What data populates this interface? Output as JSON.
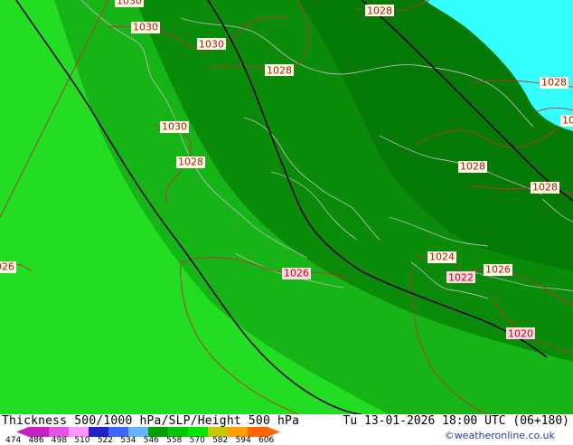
{
  "map": {
    "pressure_labels": [
      {
        "text": "1030"
      },
      {
        "text": "1030"
      },
      {
        "text": "1030"
      },
      {
        "text": "1030"
      },
      {
        "text": "1028"
      },
      {
        "text": "1028"
      },
      {
        "text": "1028"
      },
      {
        "text": "1028"
      },
      {
        "text": "1028"
      },
      {
        "text": "1028"
      },
      {
        "text": "1026"
      },
      {
        "text": "1026"
      },
      {
        "text": "1026"
      },
      {
        "text": "1024"
      },
      {
        "text": "1022"
      },
      {
        "text": "1020"
      },
      {
        "text": "10"
      }
    ],
    "colors": {
      "thickness_light": "#22dd22",
      "thickness_mid": "#16b416",
      "thickness_dark": "#0a8c0a",
      "thickness_darker": "#067a06",
      "sea_cyan": "#33ffff",
      "coastline": "#b7b7b7",
      "isobar": "#c03030",
      "height_contour": "#000000"
    }
  },
  "footer": {
    "title": "Thickness 500/1000 hPa/SLP/Height 500 hPa",
    "datetime": "Tu 13-01-2026 18:00 UTC (06+180)",
    "credit": "©weatheronline.co.uk"
  },
  "colorbar": {
    "ticks": [
      "474",
      "486",
      "498",
      "510",
      "522",
      "534",
      "546",
      "558",
      "570",
      "582",
      "594",
      "606"
    ],
    "colors": [
      "#c81ec8",
      "#e650e6",
      "#ff96ff",
      "#2020c8",
      "#3c64ff",
      "#64b4ff",
      "#00a000",
      "#00c800",
      "#00e600",
      "#c8c800",
      "#ffa000",
      "#ff6400"
    ]
  }
}
